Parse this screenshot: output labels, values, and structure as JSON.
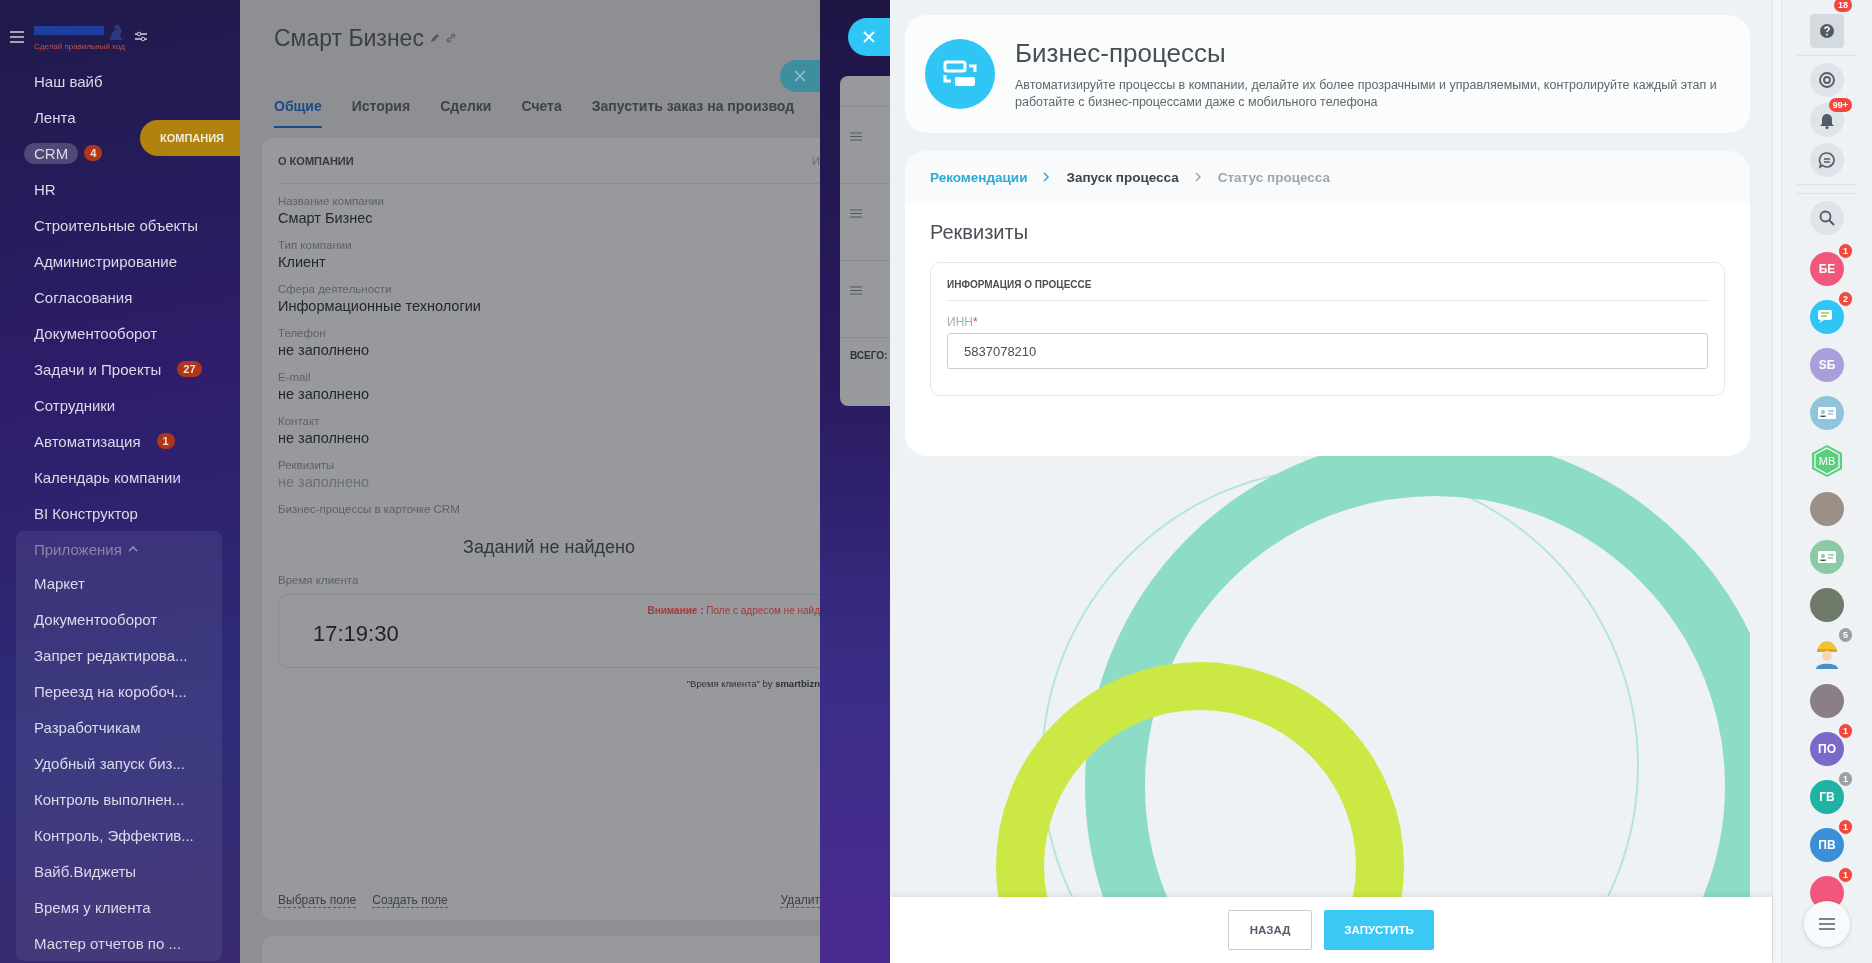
{
  "sidebar": {
    "logo_tagline": "Сделай правильный ход",
    "items": [
      {
        "label": "Наш вайб",
        "selected": false
      },
      {
        "label": "Лента",
        "selected": false
      },
      {
        "label": "CRM",
        "selected": true,
        "badge": "4"
      },
      {
        "label": "HR",
        "selected": false
      },
      {
        "label": "Строительные объекты",
        "selected": false
      },
      {
        "label": "Администрирование",
        "selected": false
      },
      {
        "label": "Согласования",
        "selected": false
      },
      {
        "label": "Документооборот",
        "selected": false
      },
      {
        "label": "Задачи и Проекты",
        "selected": false,
        "badge": "27"
      },
      {
        "label": "Сотрудники",
        "selected": false
      },
      {
        "label": "Автоматизация",
        "selected": false,
        "badge": "1"
      },
      {
        "label": "Календарь компании",
        "selected": false
      },
      {
        "label": "BI Конструктор",
        "selected": false
      }
    ],
    "apps": {
      "label": "Приложения",
      "expanded": true,
      "items": [
        "Маркет",
        "Документооборот",
        "Запрет редактирова...",
        "Переезд на коробоч...",
        "Разработчикам",
        "Удобный запуск биз...",
        "Контроль выполнен...",
        "Контроль, Эффектив...",
        "Вайб.Виджеты",
        "Время у клиента",
        "Мастер отчетов по ..."
      ]
    }
  },
  "company_tab": "КОМПАНИЯ",
  "crm_card": {
    "title": "Смарт Бизнес",
    "tabs": [
      {
        "label": "Общие",
        "selected": true
      },
      {
        "label": "История",
        "selected": false
      },
      {
        "label": "Сделки",
        "selected": false
      },
      {
        "label": "Счета",
        "selected": false
      },
      {
        "label": "Запустить заказ на производ",
        "selected": false
      }
    ],
    "section_title": "О КОМПАНИИ",
    "section_action": "И",
    "fields": [
      {
        "label": "Название компании",
        "value": "Смарт Бизнес",
        "muted": false
      },
      {
        "label": "Тип компании",
        "value": "Клиент",
        "muted": false
      },
      {
        "label": "Сфера деятельности",
        "value": "Информационные технологии",
        "muted": false
      },
      {
        "label": "Телефон",
        "value": "не заполнено",
        "muted": false
      },
      {
        "label": "E-mail",
        "value": "не заполнено",
        "muted": false
      },
      {
        "label": "Контакт",
        "value": "не заполнено",
        "muted": false
      },
      {
        "label": "Реквизиты",
        "value": "не заполнено",
        "muted": true
      }
    ],
    "bp_label": "Бизнес-процессы в карточке CRM",
    "empty_tasks": "Заданий не найдено",
    "client_time": {
      "label": "Время клиента",
      "warning_label": "Внимание :",
      "warning_text": "Поле с адресом не найд",
      "time": "17:19:30",
      "credit": "\"Время клиента\" by",
      "credit_brand": "smartbizn"
    },
    "footer_links": [
      "Выбрать поле",
      "Создать поле"
    ],
    "delete_link": "Удалит"
  },
  "side_slider": {
    "total_label": "ВСЕГО:"
  },
  "bp_panel": {
    "title": "Бизнес-процессы",
    "description": "Автоматизируйте процессы в компании, делайте их более прозрачными и управляемыми, контролируйте каждый этап и работайте с бизнес-процессами даже с мобильного телефона",
    "steps": [
      {
        "label": "Рекомендации",
        "kind": "done"
      },
      {
        "label": "Запуск процесса",
        "kind": "current"
      },
      {
        "label": "Статус процесса",
        "kind": "pending"
      }
    ],
    "form_title": "Реквизиты",
    "section_title": "ИНФОРМАЦИЯ О ПРОЦЕССЕ",
    "fields": [
      {
        "label": "ИНН",
        "required_mark": "*",
        "value": "5837078210"
      }
    ],
    "buttons": [
      {
        "label": "НАЗАД",
        "kind": "secondary"
      },
      {
        "label": "ЗАПУСТИТЬ",
        "kind": "primary"
      }
    ]
  },
  "right_bar": {
    "top": [
      {
        "kind": "help",
        "badge": "18"
      },
      {
        "kind": "copilot"
      },
      {
        "kind": "bell",
        "badge": "99+"
      },
      {
        "kind": "chat"
      },
      {
        "kind": "search"
      }
    ],
    "contacts": [
      {
        "kind": "initials",
        "text": "БЕ",
        "color": "#f0577a",
        "badge": "1",
        "badge_muted": false
      },
      {
        "kind": "chat",
        "color": "#2fc6f6",
        "badge": "2",
        "badge_muted": false
      },
      {
        "kind": "initials",
        "text": "SБ",
        "color": "#a99fdc"
      },
      {
        "kind": "card",
        "color": "#8fc4db"
      },
      {
        "kind": "hexagon",
        "text": "MB",
        "color": "#5ccf7e"
      },
      {
        "kind": "photo",
        "color": "#9c8f88"
      },
      {
        "kind": "card",
        "color": "#8cc9a6"
      },
      {
        "kind": "photo",
        "color": "#6f7a6a"
      },
      {
        "kind": "worker",
        "color": "#f2c230",
        "badge": "5",
        "badge_muted": true
      },
      {
        "kind": "photo",
        "color": "#8a7f86"
      },
      {
        "kind": "initials",
        "text": "ПО",
        "color": "#7b68c8",
        "badge": "1",
        "badge_muted": false
      },
      {
        "kind": "initials",
        "text": "ГВ",
        "color": "#20b3a3",
        "badge": "1",
        "badge_muted": true
      },
      {
        "kind": "initials",
        "text": "ПВ",
        "color": "#3b8fd6",
        "badge": "1",
        "badge_muted": false
      },
      {
        "kind": "blank",
        "color": "#f0577a",
        "badge": "1",
        "badge_muted": false
      }
    ]
  }
}
